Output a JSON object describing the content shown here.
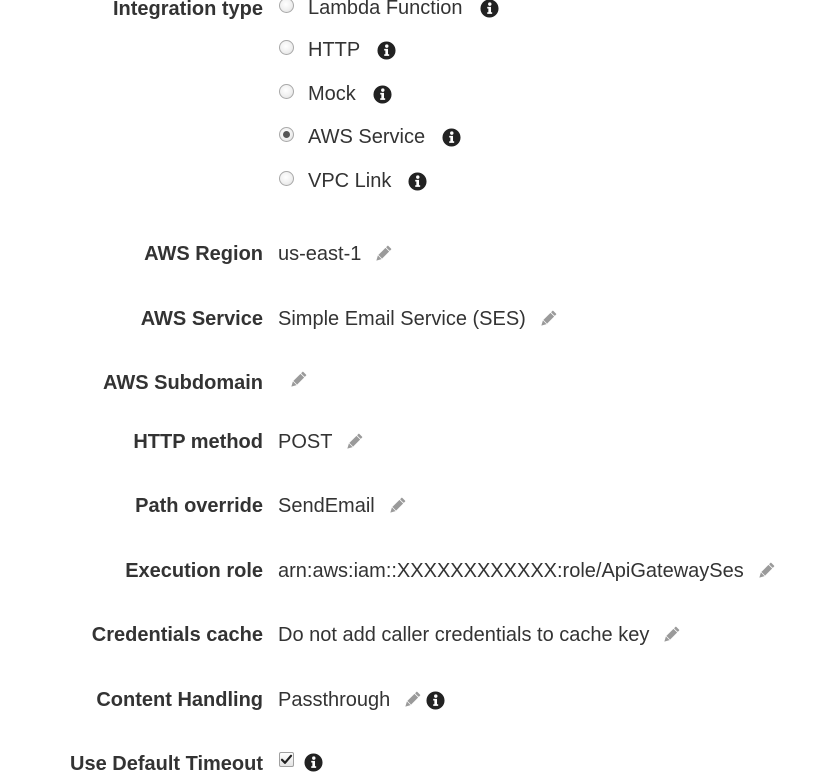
{
  "integration": {
    "label": "Integration type",
    "options": [
      {
        "label": "Lambda Function",
        "selected": false
      },
      {
        "label": "HTTP",
        "selected": false
      },
      {
        "label": "Mock",
        "selected": false
      },
      {
        "label": "AWS Service",
        "selected": true
      },
      {
        "label": "VPC Link",
        "selected": false
      }
    ]
  },
  "fields": {
    "region": {
      "label": "AWS Region",
      "value": "us-east-1"
    },
    "service": {
      "label": "AWS Service",
      "value": "Simple Email Service (SES)"
    },
    "subdomain": {
      "label": "AWS Subdomain",
      "value": ""
    },
    "http_method": {
      "label": "HTTP method",
      "value": "POST"
    },
    "path_override": {
      "label": "Path override",
      "value": "SendEmail"
    },
    "execution_role": {
      "label": "Execution role",
      "value": "arn:aws:iam::XXXXXXXXXXXX:role/ApiGatewaySes"
    },
    "credentials_cache": {
      "label": "Credentials cache",
      "value": "Do not add caller credentials to cache key"
    },
    "content_handling": {
      "label": "Content Handling",
      "value": "Passthrough"
    },
    "default_timeout": {
      "label": "Use Default Timeout",
      "checked": true
    }
  },
  "icons": {
    "info": "info-icon",
    "edit": "pencil-icon",
    "check": "checkmark-icon"
  },
  "colors": {
    "text": "#333333",
    "icon": "#222222",
    "pencil": "#9a9a9a"
  }
}
